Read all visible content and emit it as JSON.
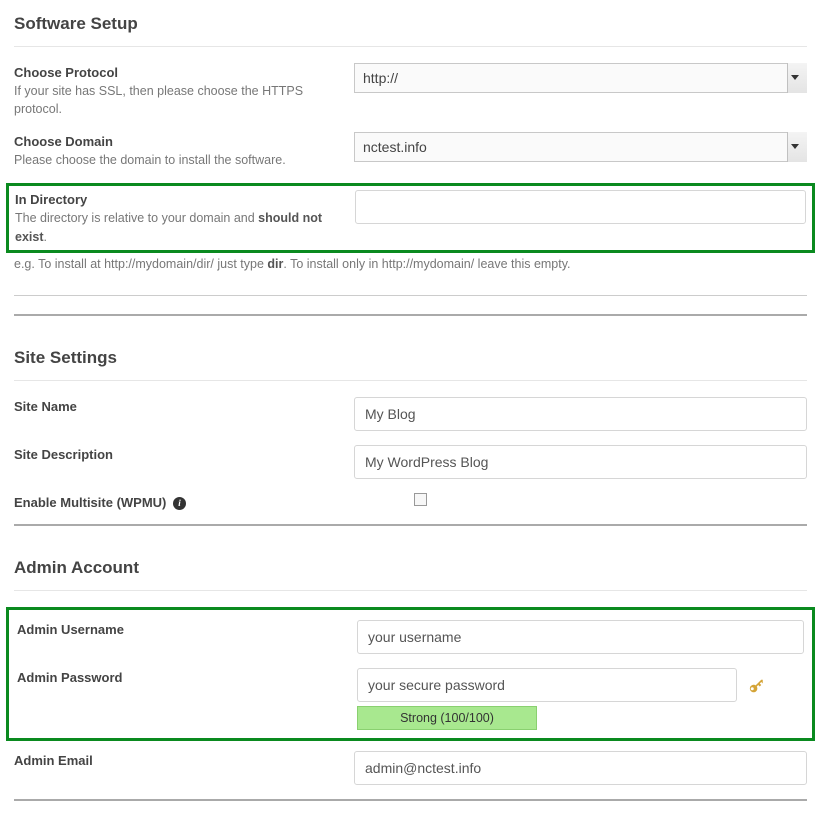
{
  "softwareSetup": {
    "title": "Software Setup",
    "chooseProtocol": {
      "label": "Choose Protocol",
      "hint": "If your site has SSL, then please choose the HTTPS protocol.",
      "value": "http://"
    },
    "chooseDomain": {
      "label": "Choose Domain",
      "hint": "Please choose the domain to install the software.",
      "value": "nctest.info"
    },
    "inDirectory": {
      "label": "In Directory",
      "hint1": "The directory is relative to your domain and ",
      "hintBold": "should not exist",
      "hint1b": ".",
      "hint2a": "e.g. To install at http://mydomain/dir/ just type ",
      "hint2bold": "dir",
      "hint2b": ". To install only in http://mydomain/ leave this empty.",
      "value": ""
    }
  },
  "siteSettings": {
    "title": "Site Settings",
    "siteName": {
      "label": "Site Name",
      "value": "My Blog"
    },
    "siteDescription": {
      "label": "Site Description",
      "value": "My WordPress Blog"
    },
    "enableMultisite": {
      "label": "Enable Multisite (WPMU)",
      "checked": false
    }
  },
  "adminAccount": {
    "title": "Admin Account",
    "username": {
      "label": "Admin Username",
      "value": "your username"
    },
    "password": {
      "label": "Admin Password",
      "value": "your secure password",
      "strength": "Strong (100/100)"
    },
    "email": {
      "label": "Admin Email",
      "value": "admin@nctest.info"
    }
  }
}
